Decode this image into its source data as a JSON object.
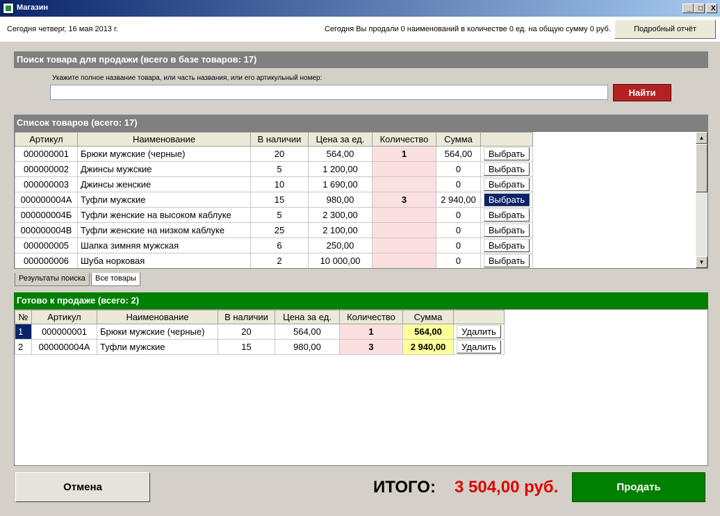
{
  "window": {
    "title": "Магазин",
    "minimize_label": "_",
    "maximize_label": "□",
    "close_label": "X"
  },
  "top": {
    "date_text": "Сегодня четверг, 16 мая 2013 г.",
    "summary_text": "Сегодня Вы продали 0 наименований в количестве 0 ед. на общую сумму 0 руб.",
    "report_button": "Подробный отчёт"
  },
  "search": {
    "header": "Поиск товара для продажи (всего в базе товаров: 17)",
    "hint": "Укажите полное название товара, или часть названия, или его артикульный номер:",
    "value": "",
    "find_button": "Найти"
  },
  "product_list": {
    "header": "Список товаров (всего: 17)",
    "columns": [
      "Артикул",
      "Наименование",
      "В наличии",
      "Цена за ед.",
      "Количество",
      "Сумма",
      ""
    ],
    "rows": [
      {
        "article": "000000001",
        "name": "Брюки мужские (черные)",
        "stock": "20",
        "price": "564,00",
        "qty": "1",
        "sum": "564,00",
        "button": "Выбрать",
        "selected": false
      },
      {
        "article": "000000002",
        "name": "Джинсы мужские",
        "stock": "5",
        "price": "1 200,00",
        "qty": "",
        "sum": "0",
        "button": "Выбрать",
        "selected": false
      },
      {
        "article": "000000003",
        "name": "Джинсы женские",
        "stock": "10",
        "price": "1 690,00",
        "qty": "",
        "sum": "0",
        "button": "Выбрать",
        "selected": false
      },
      {
        "article": "000000004А",
        "name": "Туфли мужские",
        "stock": "15",
        "price": "980,00",
        "qty": "3",
        "sum": "2 940,00",
        "button": "Выбрать",
        "selected": true
      },
      {
        "article": "000000004Б",
        "name": "Туфли женские на высоком каблуке",
        "stock": "5",
        "price": "2 300,00",
        "qty": "",
        "sum": "0",
        "button": "Выбрать",
        "selected": false
      },
      {
        "article": "000000004В",
        "name": "Туфли женские на низком каблуке",
        "stock": "25",
        "price": "2 100,00",
        "qty": "",
        "sum": "0",
        "button": "Выбрать",
        "selected": false
      },
      {
        "article": "000000005",
        "name": "Шапка зимняя мужская",
        "stock": "6",
        "price": "250,00",
        "qty": "",
        "sum": "0",
        "button": "Выбрать",
        "selected": false
      },
      {
        "article": "000000006",
        "name": "Шуба норковая",
        "stock": "2",
        "price": "10 000,00",
        "qty": "",
        "sum": "0",
        "button": "Выбрать",
        "selected": false
      }
    ],
    "scroll_up": "▲",
    "scroll_down": "▼"
  },
  "tabs": [
    "Результаты поиска",
    "Все товары"
  ],
  "ready": {
    "header": "Готово к продаже (всего: 2)",
    "columns": [
      "№",
      "Артикул",
      "Наименование",
      "В наличии",
      "Цена за ед.",
      "Количество",
      "Сумма",
      ""
    ],
    "rows": [
      {
        "n": "1",
        "article": "000000001",
        "name": "Брюки мужские (черные)",
        "stock": "20",
        "price": "564,00",
        "qty": "1",
        "sum": "564,00",
        "button": "Удалить",
        "selected": true
      },
      {
        "n": "2",
        "article": "000000004А",
        "name": "Туфли мужские",
        "stock": "15",
        "price": "980,00",
        "qty": "3",
        "sum": "2 940,00",
        "button": "Удалить",
        "selected": false
      }
    ]
  },
  "bottom": {
    "cancel_button": "Отмена",
    "total_label": "ИТОГО:",
    "total_value": "3 504,00 руб.",
    "sell_button": "Продать"
  },
  "colors": {
    "accent_red": "#b22222",
    "total_red": "#e00000",
    "ready_green": "#008000",
    "selection_blue": "#0a246a"
  }
}
